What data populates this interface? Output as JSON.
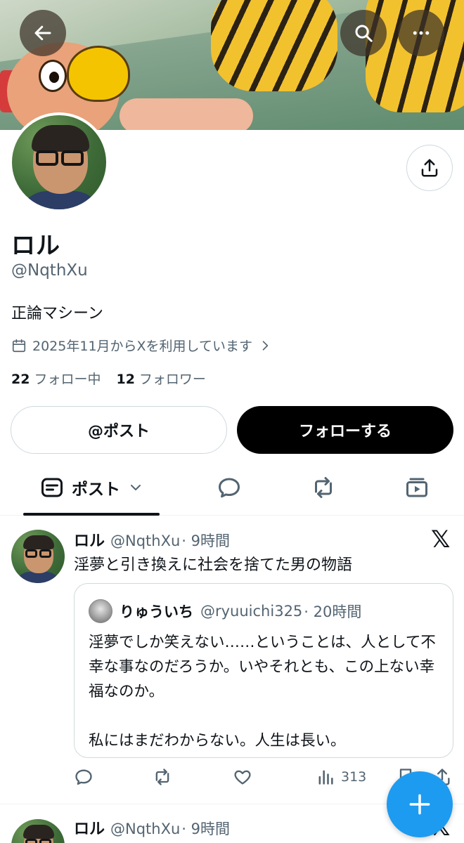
{
  "header": {
    "back_icon": "arrow-left-icon",
    "search_icon": "search-icon",
    "more_icon": "more-horizontal-icon"
  },
  "profile": {
    "name": "ロル",
    "handle": "@NqthXu",
    "bio": "正論マシーン",
    "joined": "2025年11月からXを利用しています",
    "following_count": "22",
    "following_label": "フォロー中",
    "followers_count": "12",
    "followers_label": "フォロワー",
    "mention_button": "@ポスト",
    "follow_button": "フォローする"
  },
  "tabs": {
    "active_label": "ポスト",
    "items": [
      "posts",
      "replies",
      "reposts",
      "media"
    ]
  },
  "posts": [
    {
      "name": "ロル",
      "handle": "@NqthXu",
      "time": "· 9時間",
      "text": "淫夢と引き換えに社会を捨てた男の物語",
      "quote": {
        "name": "りゅういち",
        "handle": "@ryuuichi325",
        "time": "· 20時間",
        "text": "淫夢でしか笑えない……ということは、人として不幸な事なのだろうか。いやそれとも、この上ない幸福なのか。\n\n私にはまだわからない。人生は長い。"
      },
      "views": "313"
    },
    {
      "name": "ロル",
      "handle": "@NqthXu",
      "time": "· 9時間"
    }
  ],
  "colors": {
    "accent": "#1d9bf0",
    "text_primary": "#0f1419",
    "text_secondary": "#536471",
    "border": "#cfd9de"
  }
}
